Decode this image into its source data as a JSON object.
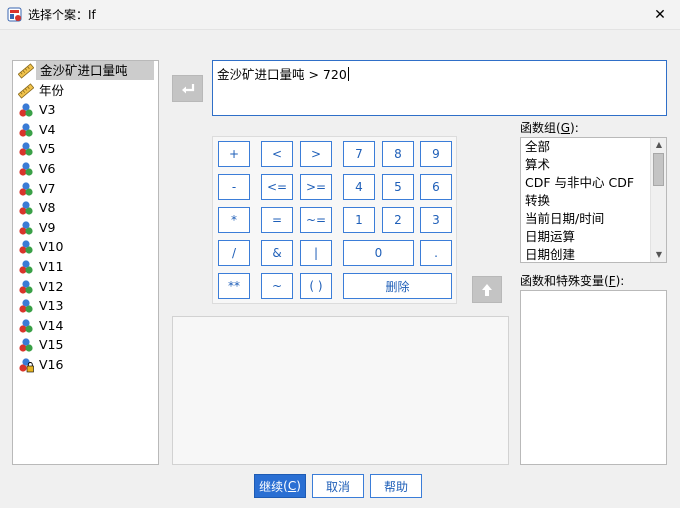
{
  "window": {
    "title": "选择个案：If",
    "close_glyph": "✕"
  },
  "variables": [
    {
      "name": "金沙矿进口量吨",
      "type": "scale",
      "selected": true
    },
    {
      "name": "年份",
      "type": "scale",
      "selected": false
    },
    {
      "name": "V3",
      "type": "nominal",
      "selected": false
    },
    {
      "name": "V4",
      "type": "nominal",
      "selected": false
    },
    {
      "name": "V5",
      "type": "nominal",
      "selected": false
    },
    {
      "name": "V6",
      "type": "nominal",
      "selected": false
    },
    {
      "name": "V7",
      "type": "nominal",
      "selected": false
    },
    {
      "name": "V8",
      "type": "nominal",
      "selected": false
    },
    {
      "name": "V9",
      "type": "nominal",
      "selected": false
    },
    {
      "name": "V10",
      "type": "nominal",
      "selected": false
    },
    {
      "name": "V11",
      "type": "nominal",
      "selected": false
    },
    {
      "name": "V12",
      "type": "nominal",
      "selected": false
    },
    {
      "name": "V13",
      "type": "nominal",
      "selected": false
    },
    {
      "name": "V14",
      "type": "nominal",
      "selected": false
    },
    {
      "name": "V15",
      "type": "nominal",
      "selected": false
    },
    {
      "name": "V16",
      "type": "nominal-locked",
      "selected": false
    }
  ],
  "expression": "金沙矿进口量吨 > 720",
  "keypad": {
    "plus": "+",
    "lt": "<",
    "gt": ">",
    "k7": "7",
    "k8": "8",
    "k9": "9",
    "minus": "-",
    "le": "<=",
    "ge": ">=",
    "k4": "4",
    "k5": "5",
    "k6": "6",
    "mul": "*",
    "eq": "=",
    "ne": "~=",
    "k1": "1",
    "k2": "2",
    "k3": "3",
    "div": "/",
    "and": "&",
    "or": "|",
    "k0": "0",
    "dot": ".",
    "pow": "**",
    "not": "~",
    "paren": "( )",
    "delete": "删除"
  },
  "function_group": {
    "label_text": "函数组",
    "mnemonic": "G",
    "items": [
      "全部",
      "算术",
      "CDF 与非中心 CDF",
      "转换",
      "当前日期/时间",
      "日期运算",
      "日期创建"
    ]
  },
  "functions_label": {
    "label_text": "函数和特殊变量",
    "mnemonic": "F"
  },
  "buttons": {
    "continue_text": "继续",
    "continue_mnemonic": "C",
    "cancel": "取消",
    "help": "帮助"
  },
  "colors": {
    "accent": "#2a6fd3",
    "key_border": "#3b7dd8",
    "key_text": "#1f5fb8"
  }
}
